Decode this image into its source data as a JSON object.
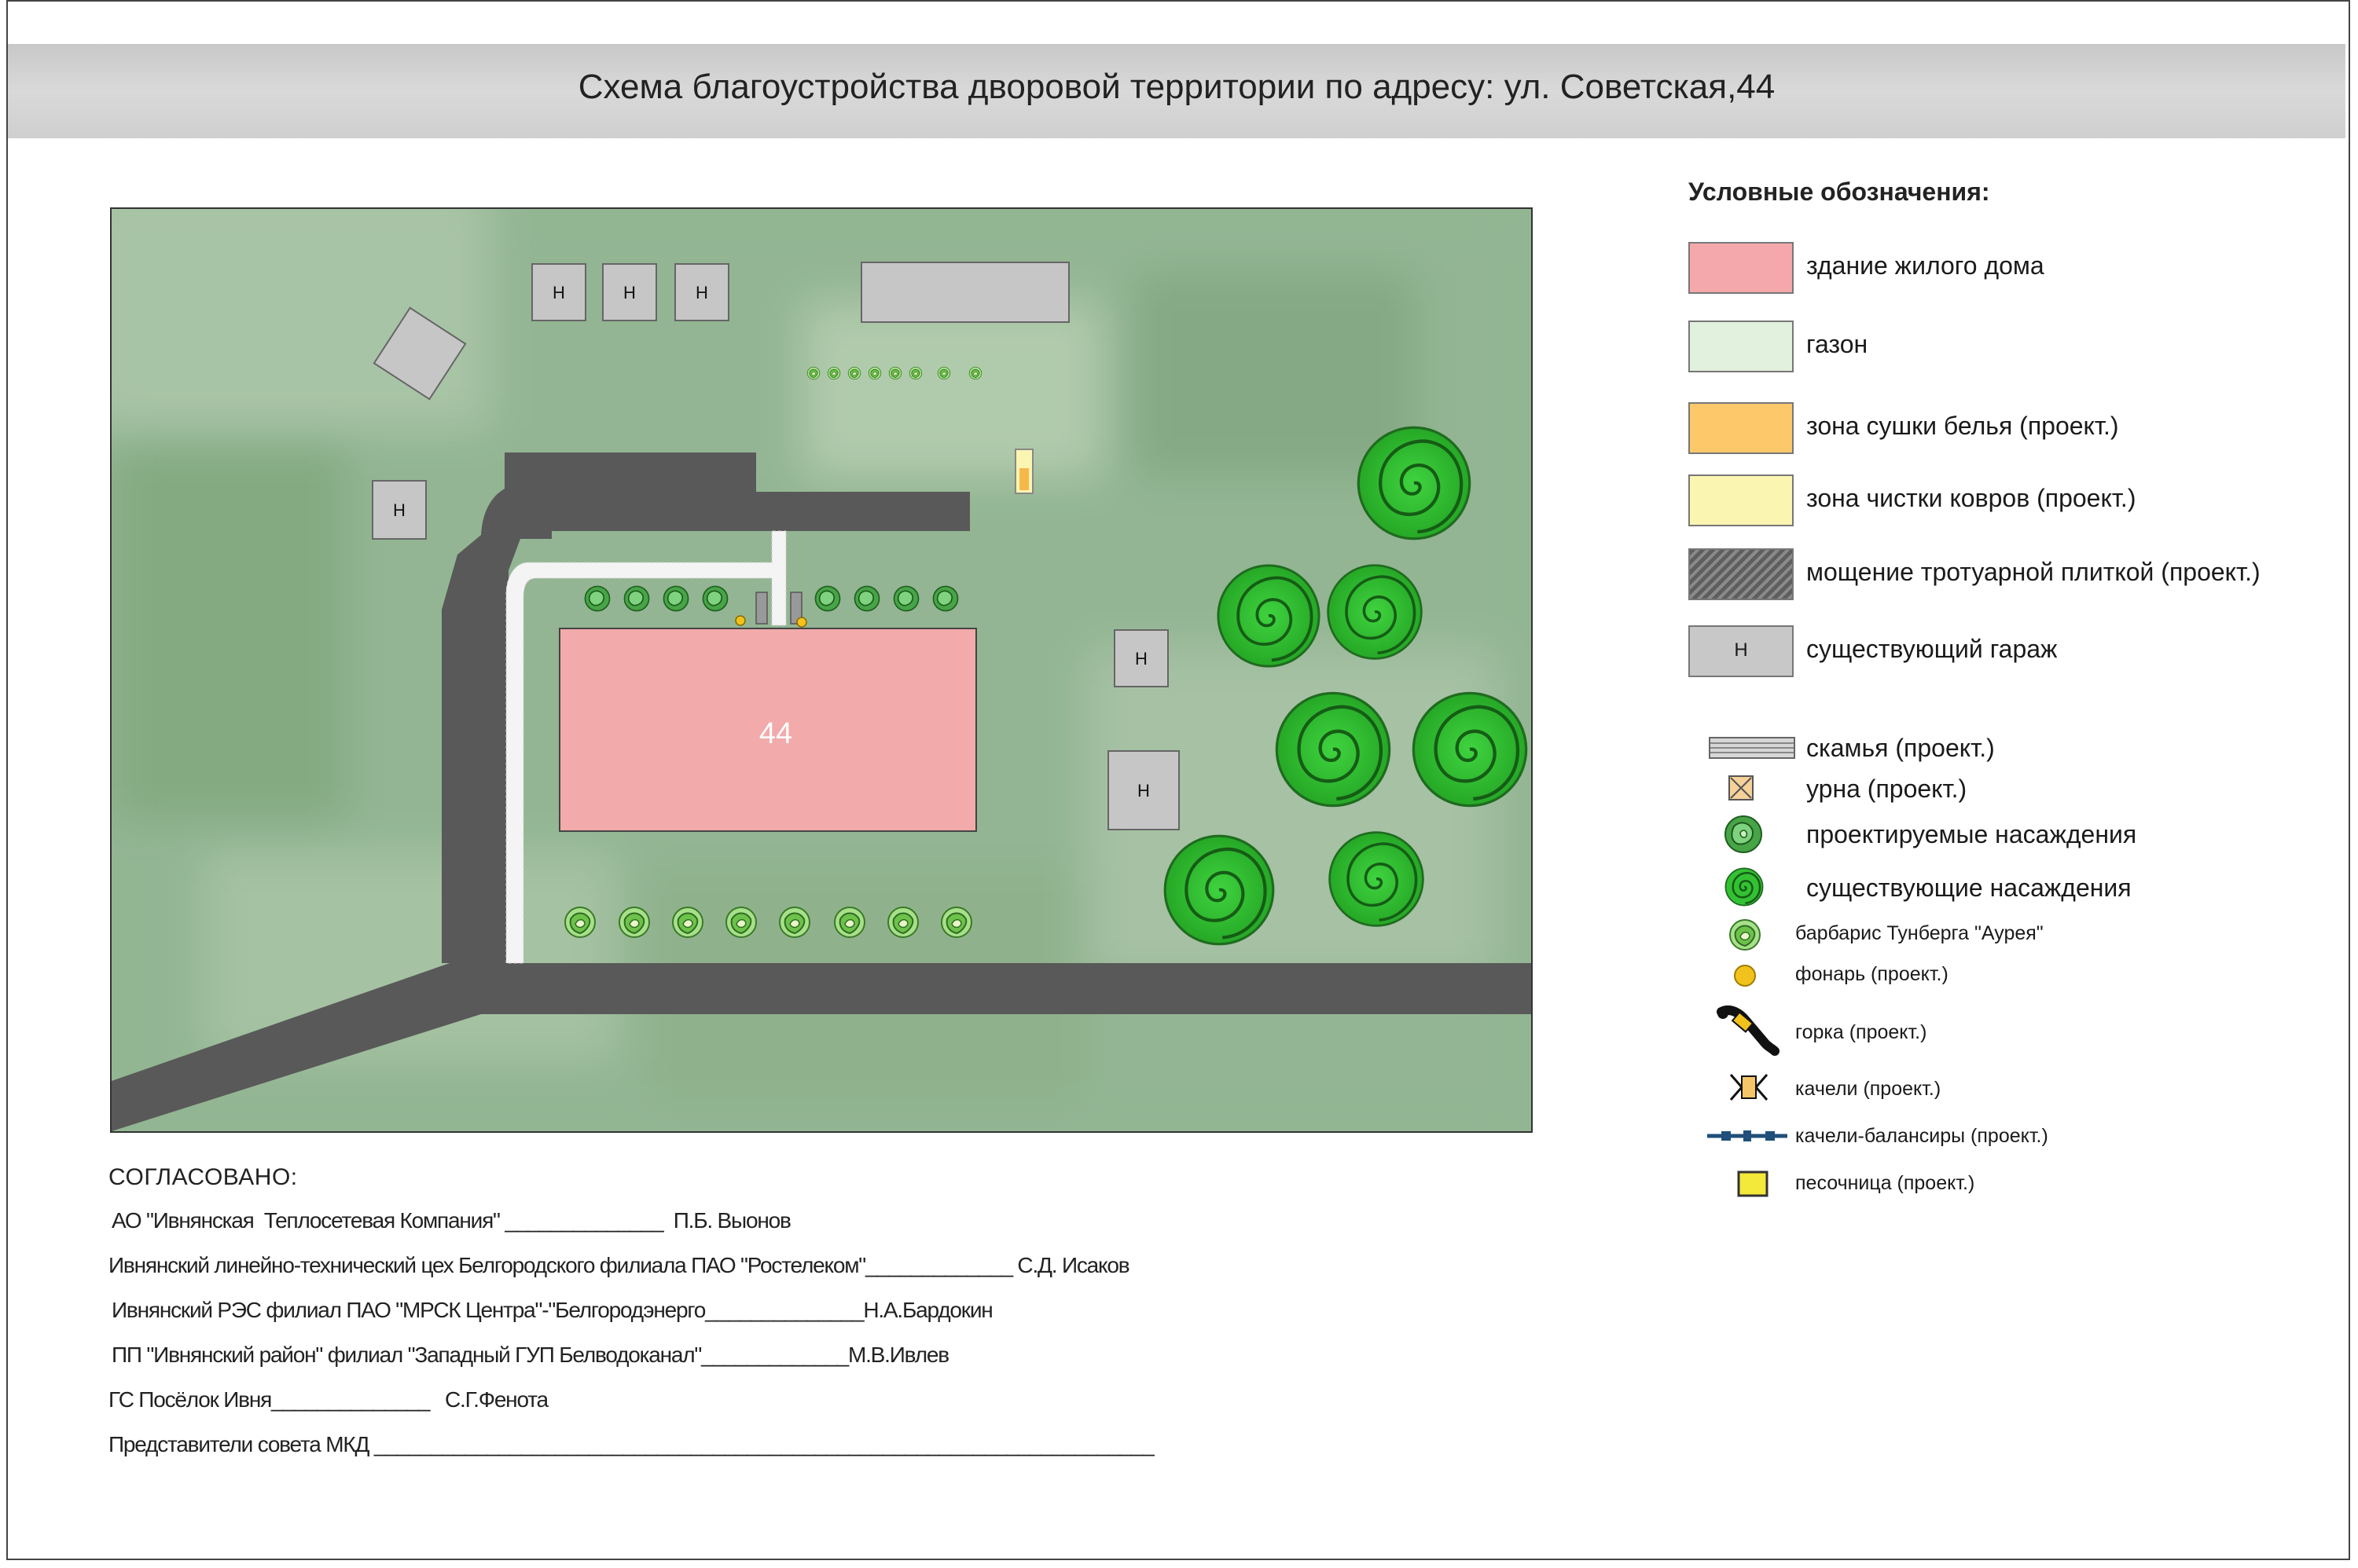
{
  "title": "Схема благоустройства дворовой территории по адресу: ул. Советская,44",
  "map": {
    "building_number": "44",
    "garage_label": "Н"
  },
  "legend": {
    "title": "Условные обозначения:",
    "items": [
      {
        "label": "здание жилого дома",
        "color": "#f5a8ac"
      },
      {
        "label": "газон",
        "color": "#e2f0de"
      },
      {
        "label": "зона сушки белья (проект.)",
        "color": "#fdc86a"
      },
      {
        "label": "зона чистки ковров (проект.)",
        "color": "#fbf5b2"
      },
      {
        "label": "мощение тротуарной плиткой (проект.)",
        "color": "#6e6e6e"
      },
      {
        "label": "существующий гараж",
        "color": "#c8c8c8",
        "symbol_text": "Н"
      },
      {
        "label": "скамья (проект.)",
        "icon": "bench-icon"
      },
      {
        "label": "урна (проект.)",
        "icon": "urn-icon"
      },
      {
        "label": "проектируемые насаждения",
        "icon": "planned-tree-icon"
      },
      {
        "label": "существующие насаждения",
        "icon": "existing-tree-icon"
      },
      {
        "label": "барбарис Тунберга \"Аурея\"",
        "icon": "barberry-icon"
      },
      {
        "label": "фонарь (проект.)",
        "icon": "lamp-icon"
      },
      {
        "label": "горка (проект.)",
        "icon": "slide-icon"
      },
      {
        "label": "качели (проект.)",
        "icon": "swing-icon"
      },
      {
        "label": "качели-балансиры (проект.)",
        "icon": "seesaw-icon"
      },
      {
        "label": "песочница (проект.)",
        "icon": "sandbox-icon",
        "color": "#f3e93a"
      }
    ]
  },
  "approvals": {
    "heading": "СОГЛАСОВАНО:",
    "lines": [
      "АО \"Ивнянская  Теплосетевая Компания\" ______________  П.Б. Выонов",
      "Ивнянский линейно-технический цех Белгородского филиала ПАО \"Ростелеком\"_____________ С.Д. Исаков",
      "Ивнянский РЭС филиал ПАО \"МРСК Центра\"-\"Белгородэнерго______________Н.А.Бардокин",
      "ПП \"Ивнянский район\" филиал \"Западный ГУП Белводоканал\"_____________М.В.Ивлев",
      "ГС Посёлок Ивня______________   С.Г.Фенота",
      "Представители совета МКД _____________________________________________________________________"
    ]
  }
}
